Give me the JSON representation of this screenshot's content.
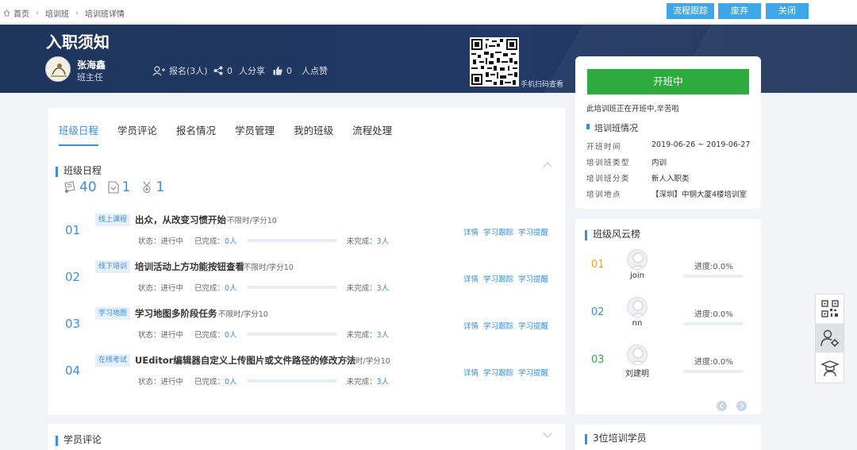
{
  "breadcrumb": [
    "首页",
    "培训班",
    "培训班详情"
  ],
  "top_actions": {
    "flow_track": "流程跟踪",
    "discard": "废弃",
    "close": "关闭"
  },
  "course": {
    "title": "入职须知",
    "teacher_name": "张海鑫",
    "teacher_role": "班主任",
    "signup": "报名(3人)",
    "share_count": "0",
    "share_label": "人分享",
    "like_count": "0",
    "like_label": "人点赞",
    "qr_caption": "手机扫码查看"
  },
  "tabs": [
    {
      "label": "班级日程",
      "active": true
    },
    {
      "label": "学员评论",
      "active": false
    },
    {
      "label": "报名情况",
      "active": false
    },
    {
      "label": "学员管理",
      "active": false
    },
    {
      "label": "我的班级",
      "active": false
    },
    {
      "label": "流程处理",
      "active": false
    }
  ],
  "schedule": {
    "title": "班级日程",
    "counts": [
      "40",
      "1",
      "1"
    ],
    "lessons": [
      {
        "num": "01",
        "tag": "线上课程",
        "name": "出众，从改变习惯开始",
        "meta": "不限时/学分10",
        "status": "状态：进行中",
        "done_label": "已完成：",
        "done": "0人",
        "undone_label": "未完成：",
        "undone": "3人",
        "progress": 0
      },
      {
        "num": "02",
        "tag": "线下培训",
        "name": "培训活动上方功能按钮查看",
        "meta": "不限时/学分10",
        "status": "状态：进行中",
        "done_label": "已完成：",
        "done": "0人",
        "undone_label": "未完成：",
        "undone": "3人",
        "progress": 0
      },
      {
        "num": "03",
        "tag": "学习地图",
        "name": "学习地图多阶段任务",
        "meta": "不限时/学分10",
        "status": "状态：进行中",
        "done_label": "已完成：",
        "done": "0人",
        "undone_label": "未完成：",
        "undone": "3人",
        "progress": 0
      },
      {
        "num": "04",
        "tag": "在线考试",
        "name": "UEditor编辑器自定义上传图片或文件路径的修改方法",
        "meta": "不限时/学分10",
        "status": "状态：进行中",
        "done_label": "已完成：",
        "done": "0人",
        "undone_label": "未完成：",
        "undone": "3人",
        "progress": 0
      }
    ],
    "actions": [
      "详情",
      "学习跟踪",
      "学习提醒"
    ]
  },
  "comments_title": "学员评论",
  "status_card": {
    "button": "开班中",
    "message": "此培训班正在开班中,辛苦啦",
    "info_title": "培训班情况",
    "rows": [
      {
        "k": "开班时间",
        "v": "2019-06-26 ~ 2019-06-27"
      },
      {
        "k": "培训班类型",
        "v": "内训"
      },
      {
        "k": "培训班分类",
        "v": "新人入职类"
      },
      {
        "k": "培训地点",
        "v": "【深圳】中钢大厦4楼培训室"
      }
    ]
  },
  "ranking": {
    "title": "班级风云榜",
    "rows": [
      {
        "num": "01",
        "name": "join",
        "progress": "进度:0.0%",
        "color": "#e8a317"
      },
      {
        "num": "02",
        "name": "nn",
        "progress": "进度:0.0%",
        "color": "#3a8ee6"
      },
      {
        "num": "03",
        "name": "刘建明",
        "progress": "进度:0.0%",
        "color": "#2dab3f"
      }
    ]
  },
  "students_title": "3位培训学员",
  "colors": {
    "accent": "#3a8ee6",
    "banner": "#1e355c",
    "open": "#2dab3f",
    "top_button": "#3fa6e8"
  },
  "icons": [
    "home-icon",
    "user-add-icon",
    "share-icon",
    "thumb-up-icon",
    "qr-code-icon",
    "user-settings-icon",
    "graduate-icon"
  ]
}
